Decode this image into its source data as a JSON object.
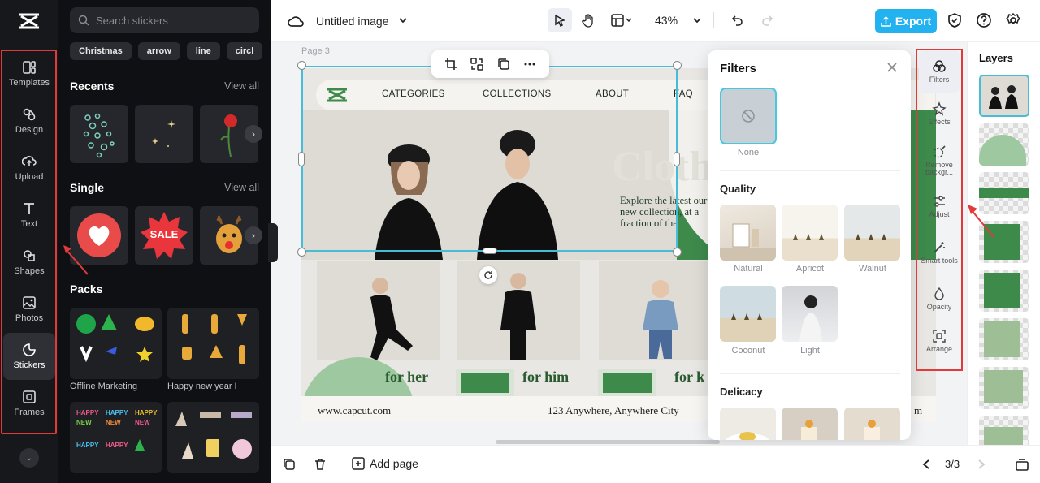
{
  "app": {
    "title": "Untitled image",
    "zoom": "43%",
    "export_label": "Export"
  },
  "rail": {
    "items": [
      {
        "label": "Templates",
        "icon": "templates-icon"
      },
      {
        "label": "Design",
        "icon": "design-icon"
      },
      {
        "label": "Upload",
        "icon": "upload-icon"
      },
      {
        "label": "Text",
        "icon": "text-icon"
      },
      {
        "label": "Shapes",
        "icon": "shapes-icon"
      },
      {
        "label": "Photos",
        "icon": "photos-icon"
      },
      {
        "label": "Stickers",
        "icon": "stickers-icon",
        "active": true
      },
      {
        "label": "Frames",
        "icon": "frames-icon"
      }
    ]
  },
  "panel": {
    "search_placeholder": "Search stickers",
    "chips": [
      "Christmas",
      "arrow",
      "line",
      "circl"
    ],
    "recents_title": "Recents",
    "single_title": "Single",
    "packs_title": "Packs",
    "view_all": "View all",
    "single_sale": "SALE",
    "packs": [
      "Offline Marketing",
      "Happy new year I"
    ]
  },
  "canvas": {
    "page_label": "Page 3",
    "nav": [
      "CATEGORIES",
      "COLLECTIONS",
      "ABOUT",
      "FAQ"
    ],
    "hero_word": "Cloth",
    "explore": "Explore the latest our new collection, at a fraction of the",
    "for_her": "for her",
    "for_him": "for him",
    "for_k": "for k",
    "website": "www.capcut.com",
    "address": "123 Anywhere, Anywhere City",
    "footer_end": "m"
  },
  "filters": {
    "title": "Filters",
    "none_label": "None",
    "quality_title": "Quality",
    "quality": [
      "Natural",
      "Apricot",
      "Walnut",
      "Coconut",
      "Light"
    ],
    "delicacy_title": "Delicacy"
  },
  "right_tools": [
    {
      "label": "Filters",
      "icon": "filters-icon",
      "active": true
    },
    {
      "label": "Effects",
      "icon": "effects-icon"
    },
    {
      "label": "Remove backgr...",
      "icon": "remove-background-icon"
    },
    {
      "label": "Adjust",
      "icon": "adjust-icon"
    },
    {
      "label": "Smart tools",
      "icon": "smart-tools-icon"
    },
    {
      "label": "Opacity",
      "icon": "opacity-icon"
    },
    {
      "label": "Arrange",
      "icon": "arrange-icon"
    }
  ],
  "layers": {
    "title": "Layers"
  },
  "bottom": {
    "add_page": "Add page",
    "pager": "3/3"
  },
  "colors": {
    "accent": "#22b2f0",
    "highlight": "#e23a3a",
    "brand_green": "#3d8a4b",
    "selection": "#47bcd6"
  }
}
